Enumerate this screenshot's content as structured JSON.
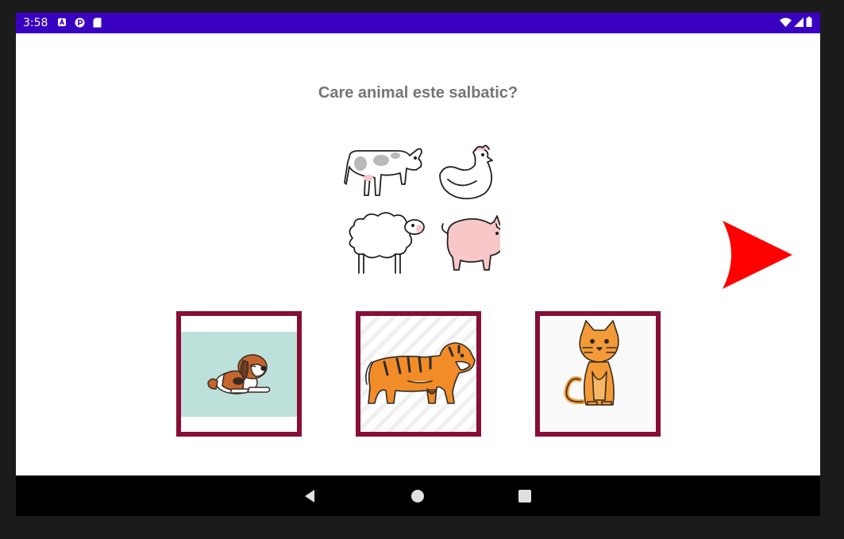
{
  "status_bar": {
    "time": "3:58",
    "left_icons": [
      "notification-a-icon",
      "notification-p-icon",
      "sd-card-icon"
    ],
    "right_icons": [
      "wifi-icon",
      "cell-signal-icon",
      "battery-icon"
    ],
    "bar_color": "#3a00c2"
  },
  "quiz": {
    "question": "Care animal este salbatic?",
    "reference_animals": [
      "cow",
      "hen",
      "sheep",
      "pig"
    ],
    "choices": [
      {
        "id": "dog",
        "icon": "dog-icon"
      },
      {
        "id": "tiger",
        "icon": "tiger-icon"
      },
      {
        "id": "cat",
        "icon": "cat-icon"
      }
    ],
    "choice_border_color": "#880e36",
    "next_arrow_color": "#ff0000"
  },
  "nav_bar": {
    "buttons": [
      "back-button",
      "home-button",
      "recents-button"
    ]
  }
}
